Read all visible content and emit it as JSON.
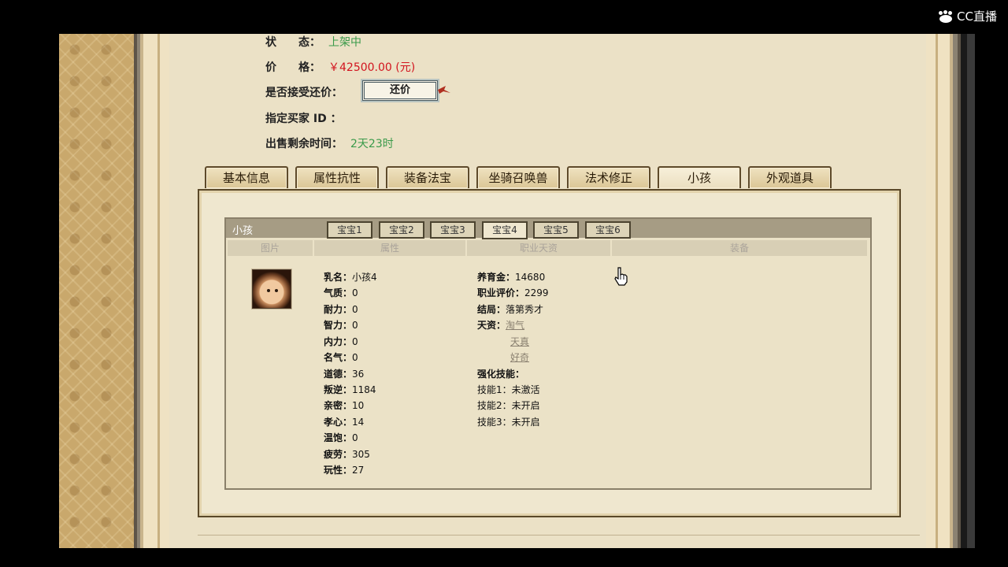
{
  "watermark": "CC直播",
  "listing": {
    "status_label": "状　　态：",
    "status_value": "上架中",
    "price_label": "价　　格：",
    "price_value": "￥42500.00 (元)",
    "counter_label": "是否接受还价：",
    "counter_button": "还价",
    "buyer_label": "指定买家 ID ：",
    "remaining_label": "出售剩余时间：",
    "remaining_value": "2天23时"
  },
  "tabs": [
    "基本信息",
    "属性抗性",
    "装备法宝",
    "坐骑召唤兽",
    "法术修正",
    "小孩",
    "外观道具"
  ],
  "active_tab": "小孩",
  "child_panel": {
    "title": "小孩",
    "subtabs": [
      "宝宝1",
      "宝宝2",
      "宝宝3",
      "宝宝4",
      "宝宝5",
      "宝宝6"
    ],
    "active_subtab": "宝宝4",
    "columns": [
      "图片",
      "属性",
      "职业天资",
      "装备"
    ]
  },
  "attributes": [
    {
      "label": "乳名",
      "value": "小孩4"
    },
    {
      "label": "气质",
      "value": "0"
    },
    {
      "label": "耐力",
      "value": "0"
    },
    {
      "label": "智力",
      "value": "0"
    },
    {
      "label": "内力",
      "value": "0"
    },
    {
      "label": "名气",
      "value": "0"
    },
    {
      "label": "道德",
      "value": "36"
    },
    {
      "label": "叛逆",
      "value": "1184"
    },
    {
      "label": "亲密",
      "value": "10"
    },
    {
      "label": "孝心",
      "value": "14"
    },
    {
      "label": "温饱",
      "value": "0"
    },
    {
      "label": "疲劳",
      "value": "305"
    },
    {
      "label": "玩性",
      "value": "27"
    }
  ],
  "career": {
    "rows": [
      {
        "label": "养育金",
        "value": "14680"
      },
      {
        "label": "职业评价",
        "value": "2299"
      },
      {
        "label": "结局",
        "value": "落第秀才"
      }
    ],
    "talent_label": "天资",
    "talents": [
      "淘气",
      "天真",
      "好奇"
    ],
    "skill_header": "强化技能",
    "skills": [
      {
        "label": "技能1",
        "value": "未激活"
      },
      {
        "label": "技能2",
        "value": "未开启"
      },
      {
        "label": "技能3",
        "value": "未开启"
      }
    ]
  }
}
